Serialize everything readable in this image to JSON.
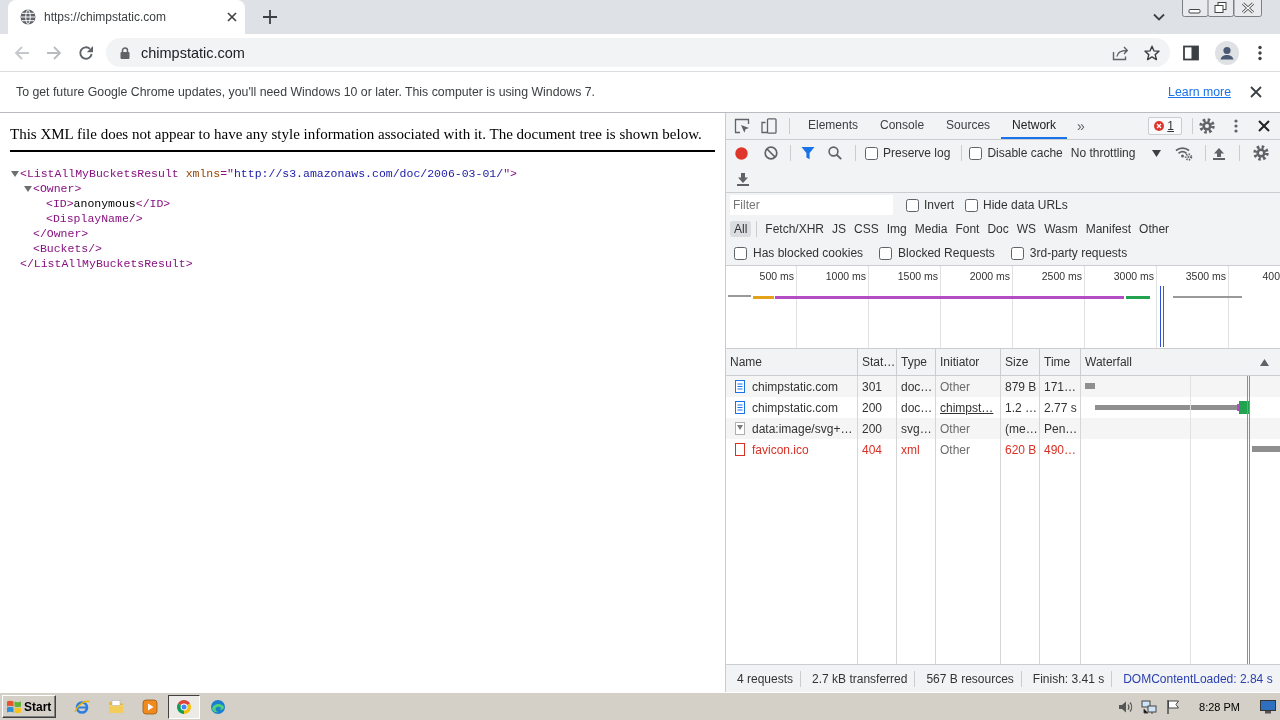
{
  "browser": {
    "tabs": [
      {
        "title": "https://chimpstatic.com",
        "selected": true
      }
    ],
    "back": {
      "disabled": true
    },
    "forward": {
      "disabled": true
    },
    "address": "chimpstatic.com"
  },
  "infobar": {
    "message": "To get future Google Chrome updates, you'll need Windows 10 or later. This computer is using Windows 7.",
    "link": "Learn more"
  },
  "page": {
    "notice": "This XML file does not appear to have any style information associated with it. The document tree is shown below.",
    "tree": [
      {
        "expanded": true,
        "line": [
          {
            "kind": "tag",
            "text": "<ListAllMyBucketsResult"
          },
          {
            "kind": "attr",
            "text": " xmlns"
          },
          {
            "kind": "tag",
            "text": "=\""
          },
          {
            "kind": "value",
            "text": "http://s3.amazonaws.com/doc/2006-03-01/"
          },
          {
            "kind": "tag",
            "text": "\">"
          }
        ],
        "children": [
          {
            "expanded": true,
            "line": [
              {
                "kind": "tag",
                "text": "<Owner>"
              }
            ],
            "children": [
              {
                "line": [
                  {
                    "kind": "tag",
                    "text": "<ID>"
                  },
                  {
                    "kind": "text",
                    "text": "anonymous"
                  },
                  {
                    "kind": "tag",
                    "text": "</ID>"
                  }
                ]
              },
              {
                "line": [
                  {
                    "kind": "tag",
                    "text": "<DisplayName/>"
                  }
                ]
              }
            ],
            "closing": [
              {
                "kind": "tag",
                "text": "</Owner>"
              }
            ]
          },
          {
            "line": [
              {
                "kind": "tag",
                "text": "<Buckets/>"
              }
            ]
          }
        ],
        "closing": [
          {
            "kind": "tag",
            "text": "</ListAllMyBucketsResult>"
          }
        ]
      }
    ]
  },
  "devtools": {
    "panel_tabs": [
      {
        "label": "Elements",
        "selected": false
      },
      {
        "label": "Console",
        "selected": false
      },
      {
        "label": "Sources",
        "selected": false
      },
      {
        "label": "Network",
        "selected": true
      }
    ],
    "more_tabs": "»",
    "error_count": "1",
    "recording": true,
    "preserve_log": {
      "label": "Preserve log",
      "checked": false
    },
    "disable_cache": {
      "label": "Disable cache",
      "checked": false
    },
    "throttling": "No throttling",
    "filter": {
      "placeholder": "Filter"
    },
    "filter_options": [
      {
        "label": "Invert",
        "checked": false
      },
      {
        "label": "Hide data URLs",
        "checked": false
      }
    ],
    "types": [
      {
        "label": "All",
        "selected": true
      },
      {
        "label": "Fetch/XHR",
        "selected": false
      },
      {
        "label": "JS",
        "selected": false
      },
      {
        "label": "CSS",
        "selected": false
      },
      {
        "label": "Img",
        "selected": false
      },
      {
        "label": "Media",
        "selected": false
      },
      {
        "label": "Font",
        "selected": false
      },
      {
        "label": "Doc",
        "selected": false
      },
      {
        "label": "WS",
        "selected": false
      },
      {
        "label": "Wasm",
        "selected": false
      },
      {
        "label": "Manifest",
        "selected": false
      },
      {
        "label": "Other",
        "selected": false
      }
    ],
    "extra_filters": [
      {
        "label": "Has blocked cookies",
        "checked": false
      },
      {
        "label": "Blocked Requests",
        "checked": false
      },
      {
        "label": "3rd-party requests",
        "checked": false
      }
    ],
    "overview": {
      "ticks": [
        "500 ms",
        "1000 ms",
        "1500 ms",
        "2000 ms",
        "2500 ms",
        "3000 ms",
        "3500 ms",
        "400"
      ]
    },
    "table": {
      "columns": [
        {
          "label": "Name",
          "sorted": false
        },
        {
          "label": "Stat…",
          "sorted": false
        },
        {
          "label": "Type",
          "sorted": false
        },
        {
          "label": "Initiator",
          "sorted": false
        },
        {
          "label": "Size",
          "sorted": false
        },
        {
          "label": "Time",
          "sorted": false
        },
        {
          "label": "Waterfall",
          "sorted": true
        }
      ],
      "rows": [
        {
          "kind": "document",
          "name": "chimpstatic.com",
          "status": "301",
          "type": "doc…",
          "initiator": "Other",
          "initiator_link": false,
          "size": "879 B",
          "time": "171…",
          "failed": false
        },
        {
          "kind": "document",
          "name": "chimpstatic.com",
          "status": "200",
          "type": "doc…",
          "initiator": "chimpst…",
          "initiator_link": true,
          "size": "1.2 …",
          "time": "2.77 s",
          "failed": false
        },
        {
          "kind": "image",
          "name": "data:image/svg+…",
          "status": "200",
          "type": "svg…",
          "initiator": "Other",
          "initiator_link": false,
          "size": "(me…",
          "time": "Pen…",
          "failed": false
        },
        {
          "kind": "file",
          "name": "favicon.ico",
          "status": "404",
          "type": "xml",
          "initiator": "Other",
          "initiator_link": false,
          "size": "620 B",
          "time": "490…",
          "failed": true
        }
      ]
    },
    "summary": [
      {
        "kind": "count",
        "text": "4 requests"
      },
      {
        "kind": "count",
        "text": "2.7 kB transferred"
      },
      {
        "kind": "count",
        "text": "567 B resources"
      },
      {
        "kind": "count",
        "text": "Finish: 3.41 s"
      },
      {
        "kind": "event",
        "text": "DOMContentLoaded: 2.84 s"
      }
    ]
  },
  "taskbar": {
    "start": "Start",
    "apps": [
      {
        "selected": false
      },
      {
        "selected": false
      },
      {
        "selected": false
      },
      {
        "selected": true
      },
      {
        "selected": false
      }
    ],
    "clock": "8:28 PM"
  }
}
